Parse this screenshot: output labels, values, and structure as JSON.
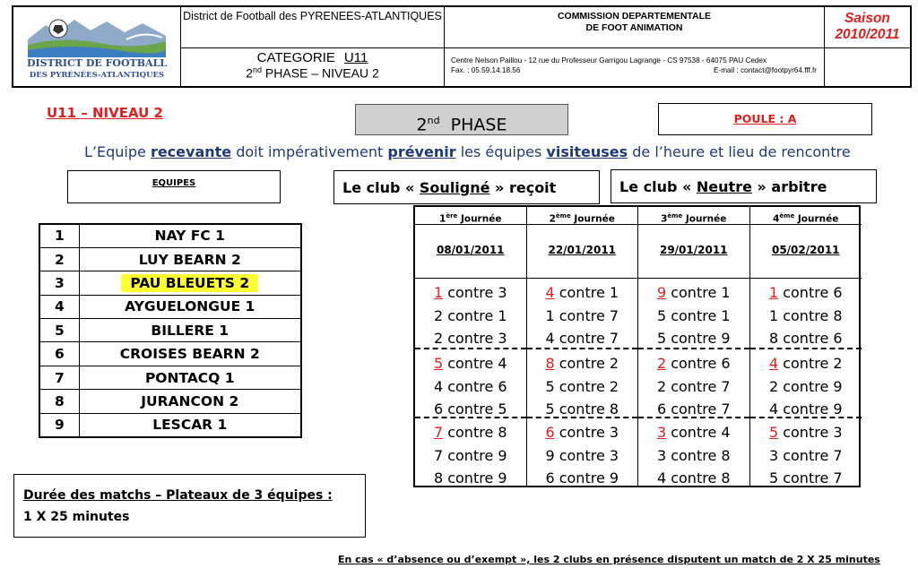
{
  "header": {
    "logo": {
      "line1": "DISTRICT DE FOOTBALL",
      "line2": "DES PYRÉNÉES-ATLANTIQUES"
    },
    "district": "District de Football des PYRENEES-ATLANTIQUES",
    "categorie_label": "CATEGORIE",
    "categorie_value": "U11",
    "phase_num": "2",
    "phase_sup": "nd",
    "phase_rest": " PHASE – NIVEAU 2",
    "commission_line1": "COMMISSION DEPARTEMENTALE",
    "commission_line2": "DE FOOT ANIMATION",
    "address": "Centre Nelson Paillou - 12 rue du Professeur Garrigou Lagrange - CS 97538  -  64075 PAU Cedex",
    "fax": "Fax. : 05.59.14.18.56",
    "email": "E-mail : contact@footpyr64.fff.fr",
    "saison_label": "Saison",
    "saison_value": "2010/2011"
  },
  "niveau_title": "U11 – NIVEAU 2",
  "phase_title": {
    "num": "2",
    "sup": "nd",
    "text": "PHASE"
  },
  "poule": "POULE : A",
  "notice": {
    "t1": "L’Equipe ",
    "b1": "recevante",
    "t2": " doit impérativement ",
    "b2": "prévenir",
    "t3": " les équipes ",
    "b3": "visiteuses",
    "t4": " de l’heure et lieu de rencontre"
  },
  "equipes_label": "EQUIPES",
  "recoit": {
    "pre": "Le club « ",
    "club": "Souligné",
    "post": " » reçoit"
  },
  "arbitre": {
    "pre": "Le club « ",
    "club": "Neutre",
    "post": " » arbitre"
  },
  "teams": [
    {
      "num": "1",
      "name": "NAY FC 1"
    },
    {
      "num": "2",
      "name": "LUY BEARN 2"
    },
    {
      "num": "3",
      "name": "PAU BLEUETS 2",
      "highlight": true
    },
    {
      "num": "4",
      "name": "AYGUELONGUE 1"
    },
    {
      "num": "5",
      "name": "BILLERE 1"
    },
    {
      "num": "6",
      "name": "CROISES BEARN 2"
    },
    {
      "num": "7",
      "name": "PONTACQ 1"
    },
    {
      "num": "8",
      "name": "JURANCON 2"
    },
    {
      "num": "9",
      "name": "LESCAR 1"
    }
  ],
  "journees": [
    {
      "num": "1",
      "sup": "ère",
      "label": " Journée",
      "date": "08/01/2011",
      "blocks": [
        [
          {
            "first": "1",
            "rest": " contre 3"
          },
          {
            "first": "2",
            "rest": " contre 1"
          },
          {
            "first": "2",
            "rest": " contre 3"
          }
        ],
        [
          {
            "first": "5",
            "rest": " contre 4"
          },
          {
            "first": "4",
            "rest": " contre 6"
          },
          {
            "first": "6",
            "rest": " contre 5"
          }
        ],
        [
          {
            "first": "7",
            "rest": " contre 8"
          },
          {
            "first": "7",
            "rest": " contre 9"
          },
          {
            "first": "8",
            "rest": " contre 9"
          }
        ]
      ]
    },
    {
      "num": "2",
      "sup": "ème",
      "label": " Journée",
      "date": "22/01/2011",
      "blocks": [
        [
          {
            "first": "4",
            "rest": " contre 1"
          },
          {
            "first": "1",
            "rest": " contre 7"
          },
          {
            "first": "4",
            "rest": " contre 7"
          }
        ],
        [
          {
            "first": "8",
            "rest": " contre 2"
          },
          {
            "first": "5",
            "rest": " contre 2"
          },
          {
            "first": "5",
            "rest": " contre 8"
          }
        ],
        [
          {
            "first": "6",
            "rest": " contre 3"
          },
          {
            "first": "9",
            "rest": " contre 3"
          },
          {
            "first": "6",
            "rest": " contre 9"
          }
        ]
      ]
    },
    {
      "num": "3",
      "sup": "ème",
      "label": " Journée",
      "date": "29/01/2011",
      "blocks": [
        [
          {
            "first": "9",
            "rest": " contre 1"
          },
          {
            "first": "5",
            "rest": " contre 1"
          },
          {
            "first": "5",
            "rest": " contre 9"
          }
        ],
        [
          {
            "first": "2",
            "rest": " contre 6"
          },
          {
            "first": "2",
            "rest": " contre 7"
          },
          {
            "first": "6",
            "rest": " contre 7"
          }
        ],
        [
          {
            "first": "3",
            "rest": " contre 4"
          },
          {
            "first": "3",
            "rest": " contre 8"
          },
          {
            "first": "4",
            "rest": " contre 8"
          }
        ]
      ]
    },
    {
      "num": "4",
      "sup": "ème",
      "label": " Journée",
      "date": "05/02/2011",
      "blocks": [
        [
          {
            "first": "1",
            "rest": " contre 6"
          },
          {
            "first": "1",
            "rest": " contre 8"
          },
          {
            "first": "8",
            "rest": " contre 6"
          }
        ],
        [
          {
            "first": "4",
            "rest": " contre 2"
          },
          {
            "first": "2",
            "rest": " contre 9"
          },
          {
            "first": "4",
            "rest": " contre 9"
          }
        ],
        [
          {
            "first": "5",
            "rest": " contre 3"
          },
          {
            "first": "3",
            "rest": " contre 7"
          },
          {
            "first": "5",
            "rest": " contre 7"
          }
        ]
      ]
    }
  ],
  "duree": {
    "line1": "Durée des matchs – Plateaux de 3 équipes :",
    "line2": "1 X 25 minutes"
  },
  "footer_note": "En cas « d’absence ou d’exempt », les 2 clubs en présence disputent un match de 2 X 25 minutes",
  "colors": {
    "red": "#e02020",
    "navy": "#1f3a7a",
    "highlight": "#ffff33",
    "phase_bg": "#d0d0d0"
  }
}
